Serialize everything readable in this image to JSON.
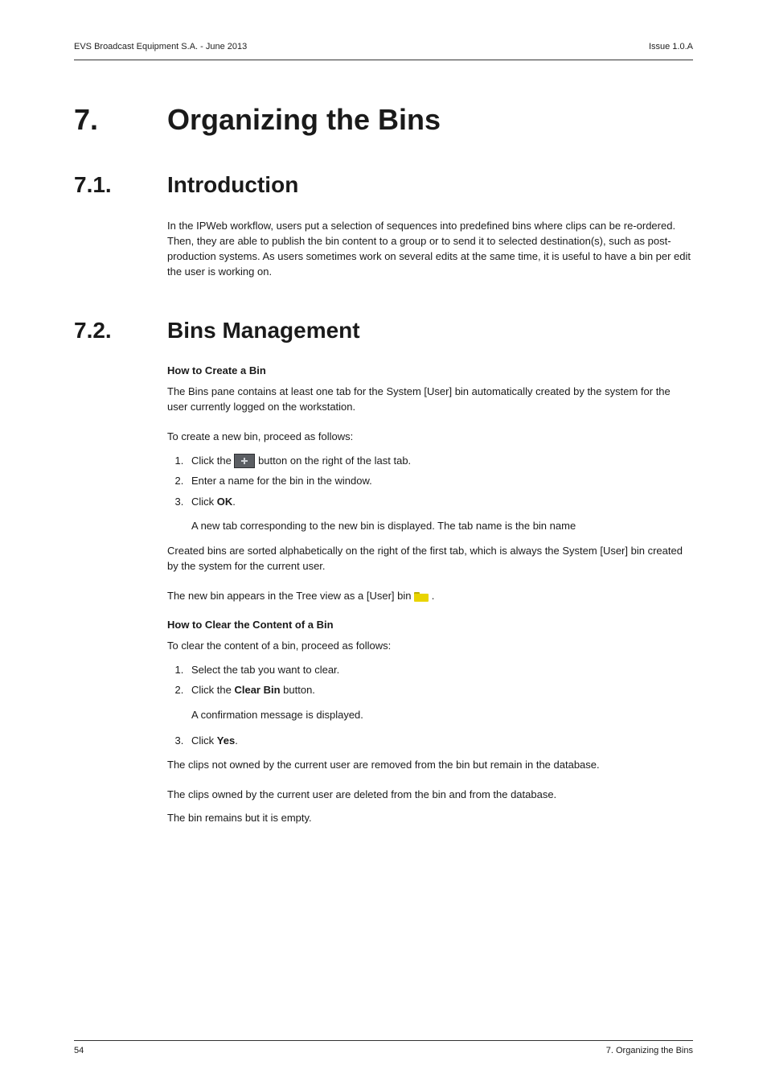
{
  "header": {
    "left": "EVS Broadcast Equipment S.A.  - June 2013",
    "right": "Issue 1.0.A"
  },
  "chapter": {
    "num": "7.",
    "title": "Organizing the Bins"
  },
  "s71": {
    "num": "7.1.",
    "title": "Introduction",
    "para": "In the IPWeb workflow, users put a selection of sequences into predefined bins where clips can be re-ordered. Then, they are able to publish the bin content to a group or to send it to selected destination(s), such as post-production systems. As users sometimes work on several edits at the same time, it is useful to have a bin per edit the user is working on."
  },
  "s72": {
    "num": "7.2.",
    "title": "Bins Management",
    "create": {
      "heading": "How to Create a Bin",
      "intro1": "The Bins pane contains at least one tab for the System [User] bin automatically created by the system for the user currently logged on the workstation.",
      "intro2": "To create a new bin, proceed as follows:",
      "step1_a": "Click the ",
      "step1_b": " button on the right of the last tab.",
      "step2": "Enter a name for the bin in the window.",
      "step3_a": "Click ",
      "step3_b": "OK",
      "step3_c": ".",
      "result": "A new tab corresponding to the new bin is displayed. The tab name is the bin name",
      "after1": "Created bins are sorted alphabetically on the right of the first tab, which is always the System [User] bin created by the system for the current user.",
      "after2_a": "The new bin appears in the Tree view as a [User] bin  ",
      "after2_b": " ."
    },
    "clear": {
      "heading": "How to Clear the Content of a Bin",
      "intro": "To clear the content of a bin, proceed as follows:",
      "step1": "Select the tab you want to clear.",
      "step2_a": "Click the ",
      "step2_b": "Clear Bin",
      "step2_c": " button.",
      "result": "A confirmation message is displayed.",
      "step3_a": "Click ",
      "step3_b": "Yes",
      "step3_c": ".",
      "after1": "The clips not owned by the current user are removed from the bin but remain in the database.",
      "after2": "The clips owned by the current user are deleted from the bin and from the database.",
      "after3": "The bin remains but it is empty."
    }
  },
  "footer": {
    "left": "54",
    "right": "7. Organizing the Bins"
  }
}
